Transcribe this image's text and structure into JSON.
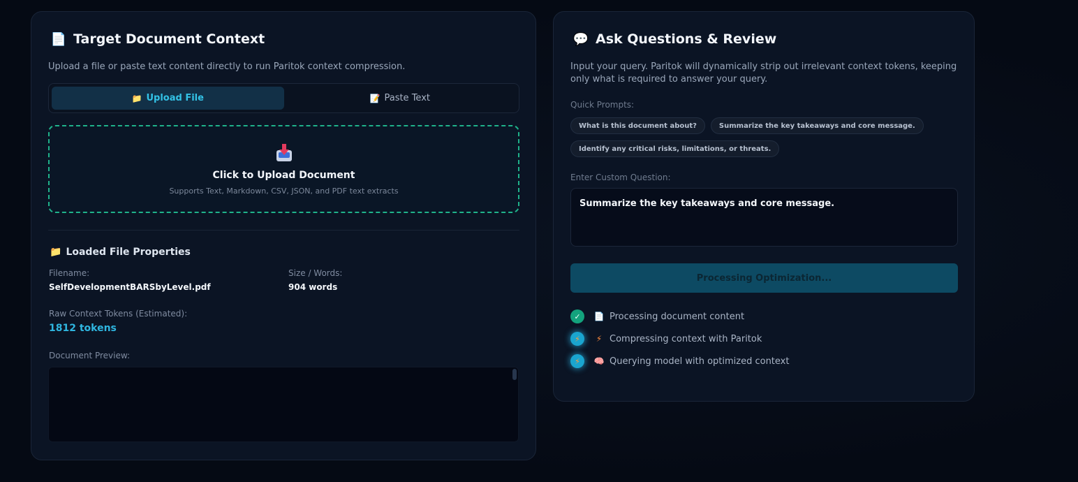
{
  "left_card": {
    "title": "Target Document Context",
    "title_icon": "page-icon",
    "description": "Upload a file or paste text content directly to run Paritok context compression.",
    "tabs": [
      {
        "label": "Upload File",
        "icon": "folder-icon",
        "active": true
      },
      {
        "label": "Paste Text",
        "icon": "memo-icon",
        "active": false
      }
    ],
    "dropzone": {
      "icon": "inbox-tray-icon",
      "title": "Click to Upload Document",
      "subtitle": "Supports Text, Markdown, CSV, JSON, and PDF text extracts"
    },
    "properties": {
      "title": "Loaded File Properties",
      "icon": "folder-icon",
      "filename_label": "Filename:",
      "filename": "SelfDevelopmentBARSbyLevel.pdf",
      "size_label": "Size / Words:",
      "size": "904 words",
      "tokens_label": "Raw Context Tokens (Estimated):",
      "tokens": "1812 tokens",
      "preview_label": "Document Preview:"
    }
  },
  "right_card": {
    "title": "Ask Questions & Review",
    "title_icon": "speech-bubble-icon",
    "description": "Input your query. Paritok will dynamically strip out irrelevant context tokens, keeping only what is required to answer your query.",
    "quick_label": "Quick Prompts:",
    "quick_prompts": [
      "What is this document about?",
      "Summarize the key takeaways and core message.",
      "Identify any critical risks, limitations, or threats."
    ],
    "custom_label": "Enter Custom Question:",
    "question_value": "Summarize the key takeaways and core message.",
    "process_button": "Processing Optimization...",
    "steps": [
      {
        "label": "Processing document content",
        "status": "done",
        "icon": "page-icon"
      },
      {
        "label": "Compressing context with Paritok",
        "status": "active",
        "icon": "lightning-icon"
      },
      {
        "label": "Querying model with optimized context",
        "status": "active",
        "icon": "brain-icon"
      }
    ]
  },
  "colors": {
    "accent": "#33c2e6",
    "dropzone_border": "#1fb28a",
    "success": "#13a37d",
    "button_bg": "#0d4a63"
  }
}
